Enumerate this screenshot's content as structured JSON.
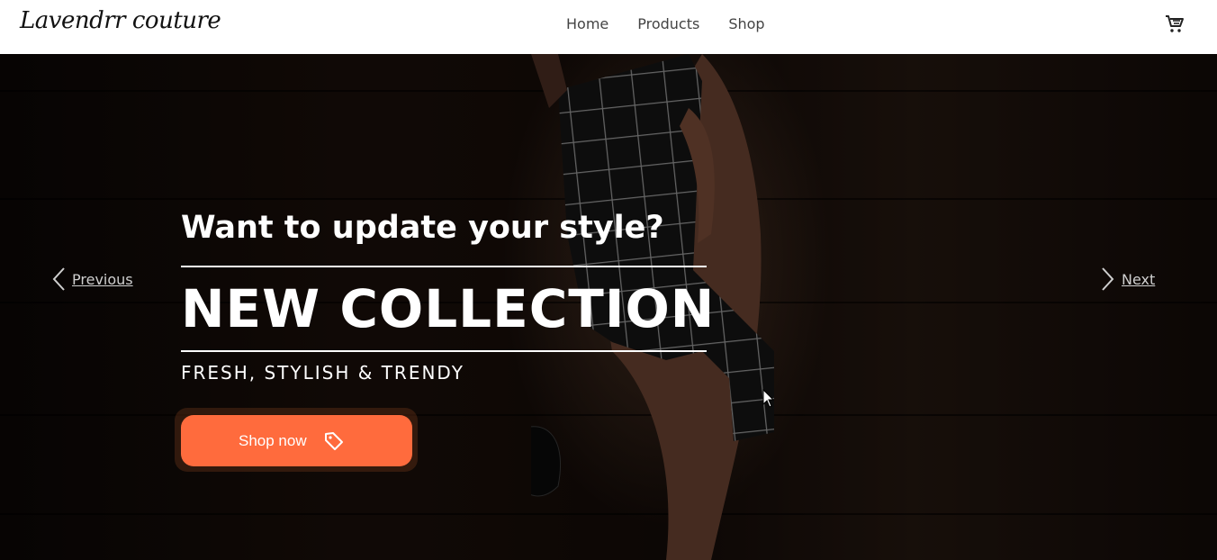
{
  "header": {
    "brand": "Lavendrr couture",
    "nav": [
      "Home",
      "Products",
      "Shop"
    ],
    "cart_icon": "shopping-cart-icon"
  },
  "hero": {
    "tagline": "Want to update your style?",
    "headline": "NEW COLLECTION",
    "subline": "FRESH, STYLISH & TRENDY",
    "cta_label": "Shop now",
    "cta_icon": "tag-icon",
    "prev_label": "Previous",
    "next_label": "Next",
    "accent_color": "#ff6b3d"
  }
}
